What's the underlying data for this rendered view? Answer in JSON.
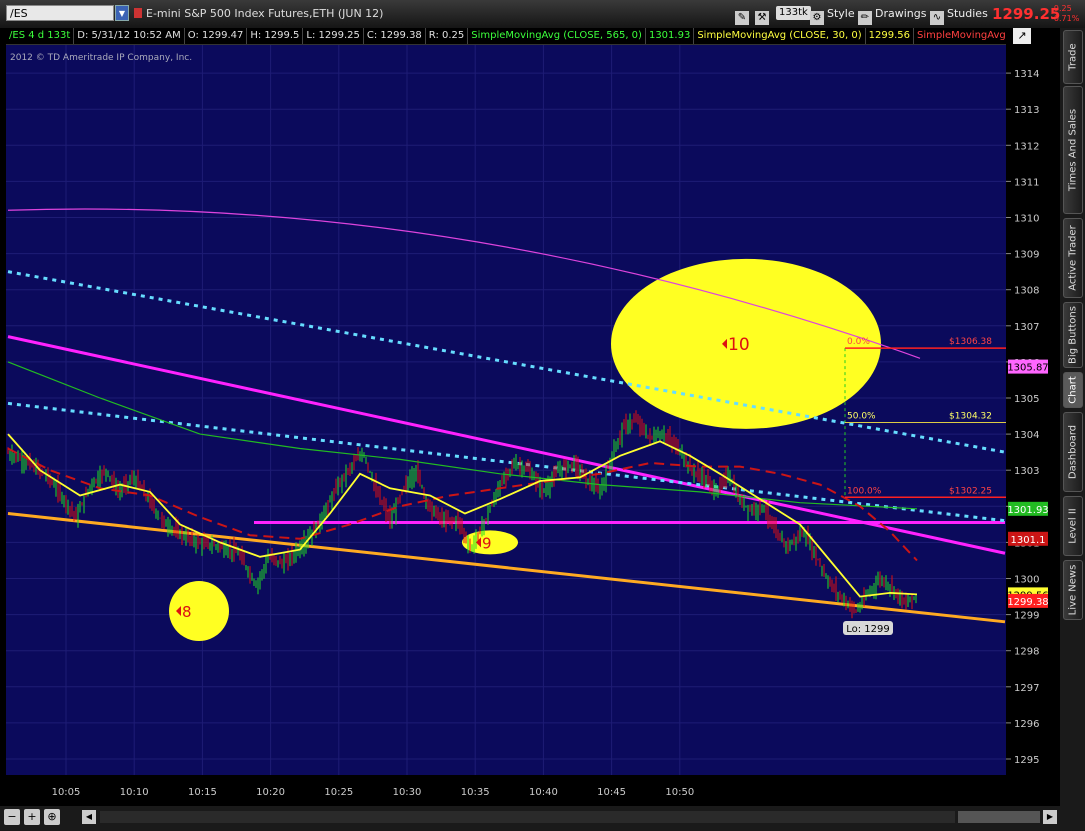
{
  "header": {
    "symbol": "/ES",
    "instrument": "E-mini S&P 500 Index Futures,ETH (JUN 12)",
    "tick_badge": "133tk",
    "style_label": "Style",
    "drawings_label": "Drawings",
    "studies_label": "Studies",
    "last_price": "1299.25",
    "change": "-9.25",
    "change_pct": "-0.71%"
  },
  "infobar": {
    "period": "/ES 4 d 133t",
    "date": "D: 5/31/12 10:52 AM",
    "open": "O: 1299.47",
    "high": "H: 1299.5",
    "low": "L: 1299.25",
    "close": "C: 1299.38",
    "range": "R: 0.25",
    "sma1_label": "SimpleMovingAvg (CLOSE, 565, 0)",
    "sma1_value": "1301.93",
    "sma2_label": "SimpleMovingAvg (CLOSE, 30, 0)",
    "sma2_value": "1299.56",
    "sma3_label": "SimpleMovingAvg (C..."
  },
  "copyright": "2012 © TD Ameritrade IP Company, Inc.",
  "side_tabs": [
    "Trade",
    "Times And Sales",
    "Active Trader",
    "Big Buttons",
    "Chart",
    "Dashboard",
    "Level II",
    "Live News"
  ],
  "colors": {
    "background": "#0b0a5c",
    "up_candle": "#22dd22",
    "down_candle": "#e01010",
    "sma_fast": "#ffff30",
    "sma_slow": "#22bb22",
    "sma_red": "#cc1515",
    "trendline_magenta": "#ff22ff",
    "trendline_orange": "#ffaa22",
    "channel_cyan": "#66ddff",
    "annotation_yellow": "#ffff22",
    "fib_red": "#ff2020"
  },
  "chart_data": {
    "type": "candlestick",
    "title": "",
    "y_range": [
      1294.5,
      1315
    ],
    "y_ticks": [
      1295,
      1296,
      1297,
      1298,
      1299,
      1300,
      1301,
      1302,
      1303,
      1304,
      1305,
      1306,
      1307,
      1308,
      1309,
      1310,
      1311,
      1312,
      1313,
      1314
    ],
    "x_ticks": [
      "10:05",
      "10:10",
      "10:15",
      "10:20",
      "10:25",
      "10:30",
      "10:35",
      "10:40",
      "10:45",
      "10:50"
    ],
    "price_path": [
      [
        8,
        1303.5
      ],
      [
        30,
        1303.2
      ],
      [
        50,
        1302.8
      ],
      [
        65,
        1302.2
      ],
      [
        78,
        1301.7
      ],
      [
        92,
        1302.6
      ],
      [
        108,
        1303.0
      ],
      [
        120,
        1302.4
      ],
      [
        135,
        1302.8
      ],
      [
        150,
        1302.2
      ],
      [
        163,
        1301.6
      ],
      [
        178,
        1301.3
      ],
      [
        198,
        1301.0
      ],
      [
        220,
        1300.9
      ],
      [
        240,
        1300.7
      ],
      [
        258,
        1299.8
      ],
      [
        270,
        1300.6
      ],
      [
        285,
        1300.4
      ],
      [
        300,
        1300.8
      ],
      [
        320,
        1301.5
      ],
      [
        340,
        1302.6
      ],
      [
        355,
        1303.2
      ],
      [
        365,
        1303.5
      ],
      [
        378,
        1302.4
      ],
      [
        392,
        1301.6
      ],
      [
        405,
        1302.5
      ],
      [
        418,
        1303.0
      ],
      [
        430,
        1302.0
      ],
      [
        445,
        1301.6
      ],
      [
        460,
        1301.6
      ],
      [
        472,
        1300.8
      ],
      [
        485,
        1301.5
      ],
      [
        500,
        1302.5
      ],
      [
        515,
        1303.2
      ],
      [
        530,
        1303.0
      ],
      [
        545,
        1302.4
      ],
      [
        560,
        1303.0
      ],
      [
        575,
        1303.2
      ],
      [
        590,
        1302.7
      ],
      [
        602,
        1302.4
      ],
      [
        612,
        1303.3
      ],
      [
        625,
        1304.2
      ],
      [
        638,
        1304.4
      ],
      [
        650,
        1303.9
      ],
      [
        665,
        1304.0
      ],
      [
        680,
        1303.6
      ],
      [
        693,
        1303.0
      ],
      [
        705,
        1302.8
      ],
      [
        718,
        1302.4
      ],
      [
        730,
        1302.9
      ],
      [
        740,
        1302.2
      ],
      [
        752,
        1301.9
      ],
      [
        765,
        1302.0
      ],
      [
        778,
        1301.2
      ],
      [
        790,
        1300.9
      ],
      [
        805,
        1301.3
      ],
      [
        818,
        1300.6
      ],
      [
        830,
        1299.9
      ],
      [
        845,
        1299.4
      ],
      [
        858,
        1299.1
      ],
      [
        870,
        1299.6
      ],
      [
        882,
        1300.0
      ],
      [
        895,
        1299.7
      ],
      [
        907,
        1299.3
      ],
      [
        917,
        1299.5
      ]
    ],
    "sma_fast_path": [
      [
        8,
        1304.0
      ],
      [
        40,
        1303.0
      ],
      [
        80,
        1302.3
      ],
      [
        120,
        1302.6
      ],
      [
        150,
        1302.4
      ],
      [
        180,
        1301.5
      ],
      [
        220,
        1301.0
      ],
      [
        260,
        1300.6
      ],
      [
        300,
        1300.8
      ],
      [
        330,
        1301.8
      ],
      [
        360,
        1302.9
      ],
      [
        390,
        1302.5
      ],
      [
        430,
        1302.3
      ],
      [
        465,
        1301.8
      ],
      [
        500,
        1302.2
      ],
      [
        540,
        1302.7
      ],
      [
        580,
        1302.8
      ],
      [
        620,
        1303.4
      ],
      [
        660,
        1303.8
      ],
      [
        690,
        1303.4
      ],
      [
        720,
        1302.9
      ],
      [
        760,
        1302.2
      ],
      [
        800,
        1301.5
      ],
      [
        830,
        1300.5
      ],
      [
        860,
        1299.5
      ],
      [
        890,
        1299.6
      ],
      [
        917,
        1299.56
      ]
    ],
    "sma_red_path": [
      [
        8,
        1303.6
      ],
      [
        50,
        1303.0
      ],
      [
        100,
        1302.5
      ],
      [
        150,
        1302.3
      ],
      [
        200,
        1301.7
      ],
      [
        250,
        1301.2
      ],
      [
        300,
        1301.1
      ],
      [
        350,
        1301.5
      ],
      [
        400,
        1302.0
      ],
      [
        450,
        1302.3
      ],
      [
        500,
        1302.5
      ],
      [
        550,
        1302.7
      ],
      [
        600,
        1302.9
      ],
      [
        650,
        1303.2
      ],
      [
        700,
        1303.1
      ],
      [
        740,
        1303.1
      ],
      [
        780,
        1302.9
      ],
      [
        820,
        1302.6
      ],
      [
        860,
        1302.0
      ],
      [
        890,
        1301.3
      ],
      [
        917,
        1300.5
      ]
    ],
    "sma_slow_path": [
      [
        8,
        1306.0
      ],
      [
        100,
        1305.0
      ],
      [
        200,
        1304.0
      ],
      [
        300,
        1303.6
      ],
      [
        400,
        1303.3
      ],
      [
        500,
        1302.9
      ],
      [
        600,
        1302.6
      ],
      [
        700,
        1302.4
      ],
      [
        800,
        1302.1
      ],
      [
        917,
        1301.93
      ]
    ],
    "trendlines": [
      {
        "name": "upper-magenta",
        "from": [
          8,
          1306.7
        ],
        "to": [
          1005,
          1300.7
        ]
      },
      {
        "name": "magenta-horizontal",
        "from": [
          254,
          1301.55
        ],
        "to": [
          1005,
          1301.55
        ]
      },
      {
        "name": "orange-support",
        "from": [
          8,
          1301.8
        ],
        "to": [
          1005,
          1298.8
        ]
      },
      {
        "name": "cyan-upper",
        "from": [
          8,
          1308.5
        ],
        "to": [
          1005,
          1303.5
        ]
      },
      {
        "name": "cyan-lower",
        "from": [
          8,
          1304.85
        ],
        "to": [
          1005,
          1301.6
        ]
      },
      {
        "name": "magenta-curve",
        "from": [
          8,
          1310.2
        ],
        "to": [
          920,
          1306.1
        ]
      }
    ],
    "fib_retracement": [
      {
        "level": "0.0%",
        "price_label": "$1306.38",
        "price": 1306.38
      },
      {
        "level": "50.0%",
        "price_label": "$1304.32",
        "price": 1304.32
      },
      {
        "level": "100.0%",
        "price_label": "$1302.25",
        "price": 1302.25
      }
    ],
    "annotations": [
      {
        "label": "8",
        "x": 204,
        "price": 1299.1
      },
      {
        "label": "9",
        "x": 490,
        "price": 1301.0
      },
      {
        "label": "10",
        "x": 746,
        "price": 1306.5
      }
    ],
    "low_label": "Lo: 1299",
    "price_labels": [
      {
        "value": "1305.87",
        "price": 1305.87,
        "bg": "#ff66ff",
        "fg": "#000000"
      },
      {
        "value": "1301.93",
        "price": 1301.93,
        "bg": "#22bb22",
        "fg": "#ffffff"
      },
      {
        "value": "1301.1",
        "price": 1301.1,
        "bg": "#cc1515",
        "fg": "#ffffff"
      },
      {
        "value": "1299.56",
        "price": 1299.56,
        "bg": "#ffff30",
        "fg": "#000000"
      },
      {
        "value": "1299.38",
        "price": 1299.38,
        "bg": "#ff2020",
        "fg": "#ffffff"
      }
    ]
  }
}
